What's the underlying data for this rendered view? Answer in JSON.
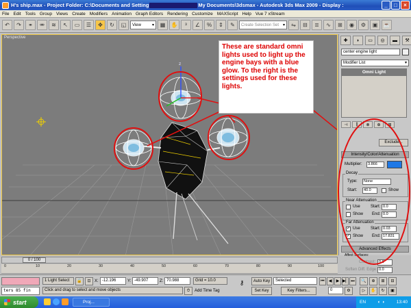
{
  "window": {
    "title_pre": "H's ship.max - Project Folder: C:\\Documents and Setting",
    "title_post": "My Documents\\3dsmax - Autodesk 3ds Max 2009 - Display :",
    "btn_min": "_",
    "btn_max": "□",
    "btn_close": "×"
  },
  "menu": [
    "File",
    "Edit",
    "Tools",
    "Group",
    "Views",
    "Create",
    "Modifiers",
    "Animation",
    "Graph Editors",
    "Rendering",
    "Customize",
    "MAXScript",
    "Help",
    "Vue 7 xStream"
  ],
  "toolbar": {
    "view_dropdown": "View",
    "selection_set_placeholder": "Create Selection Set",
    "icons": [
      "undo",
      "redo",
      "link",
      "unlink",
      "bind",
      "select",
      "select-region",
      "select-name",
      "move",
      "rotate",
      "scale",
      "snap",
      "angle-snap",
      "percent-snap",
      "mirror",
      "align",
      "layer",
      "curve-editor",
      "material",
      "render-setup",
      "render",
      "quick-render"
    ]
  },
  "viewport": {
    "label": "Perspective",
    "gizmo_axis": "z",
    "annotation": "These are standard omni lights used to light up the engine bays with a blue glow. To the right is the settings used for these lights.",
    "accent": "#e01010"
  },
  "command_panel": {
    "tabs": [
      "✚",
      "◗",
      "▭",
      "◎",
      "▬",
      "⚒"
    ],
    "object_name": "center engine light",
    "modifier_list": "Modifier List",
    "stack_item": "Omni Light",
    "icon_row": [
      "⊣",
      "||",
      "⊗",
      "⊕",
      "⊞"
    ],
    "exclude": "Exclude...",
    "rollout_intensity": "Intensity/Color/Attenuation",
    "multiplier_label": "Multiplier:",
    "multiplier": "3.866",
    "light_color": "#1e78e6",
    "decay_label": "Decay",
    "type_label": "Type:",
    "decay_type": "None",
    "start_label": "Start:",
    "decay_start": "40.0",
    "show_label": "Show",
    "near_label": "Near Attenuation",
    "use_label": "Use",
    "start_short": "Start:",
    "end_label": "End:",
    "near_start": "0.0",
    "near_end": "0.0",
    "far_label": "Far Attenuation",
    "far_start": "0.03",
    "far_end": "17.831",
    "check_mark": "✓",
    "advanced": "Advanced Effects",
    "affect_surfaces": "Affect Surfaces:",
    "contrast_label": "Contrast:",
    "contrast": "0.0",
    "soften_label": "Soften Diff. Edge:",
    "soften": "0.0"
  },
  "timeline": {
    "slider": "0 / 100",
    "ticks": [
      "0",
      "10",
      "20",
      "30",
      "40",
      "50",
      "60",
      "70",
      "80",
      "90",
      "100"
    ]
  },
  "status": {
    "listener": "ters 85 fin",
    "selection": "1 Light Select",
    "x_label": "X:",
    "x": "-12.196",
    "y_label": "Y:",
    "y": "-49.907",
    "z_label": "Z:",
    "z": "70.988",
    "grid": "Grid = 10.0",
    "prompt": "Click and drag to select and move objects",
    "add_time_tag": "Add Time Tag",
    "auto_key": "Auto Key",
    "set_key": "Set Key",
    "key_mode": "Selected",
    "key_filters": "Key Filters...",
    "frame": "0"
  },
  "taskbar": {
    "start": "start",
    "item": "Proj...",
    "lang": "EN",
    "clock": "13:40"
  }
}
